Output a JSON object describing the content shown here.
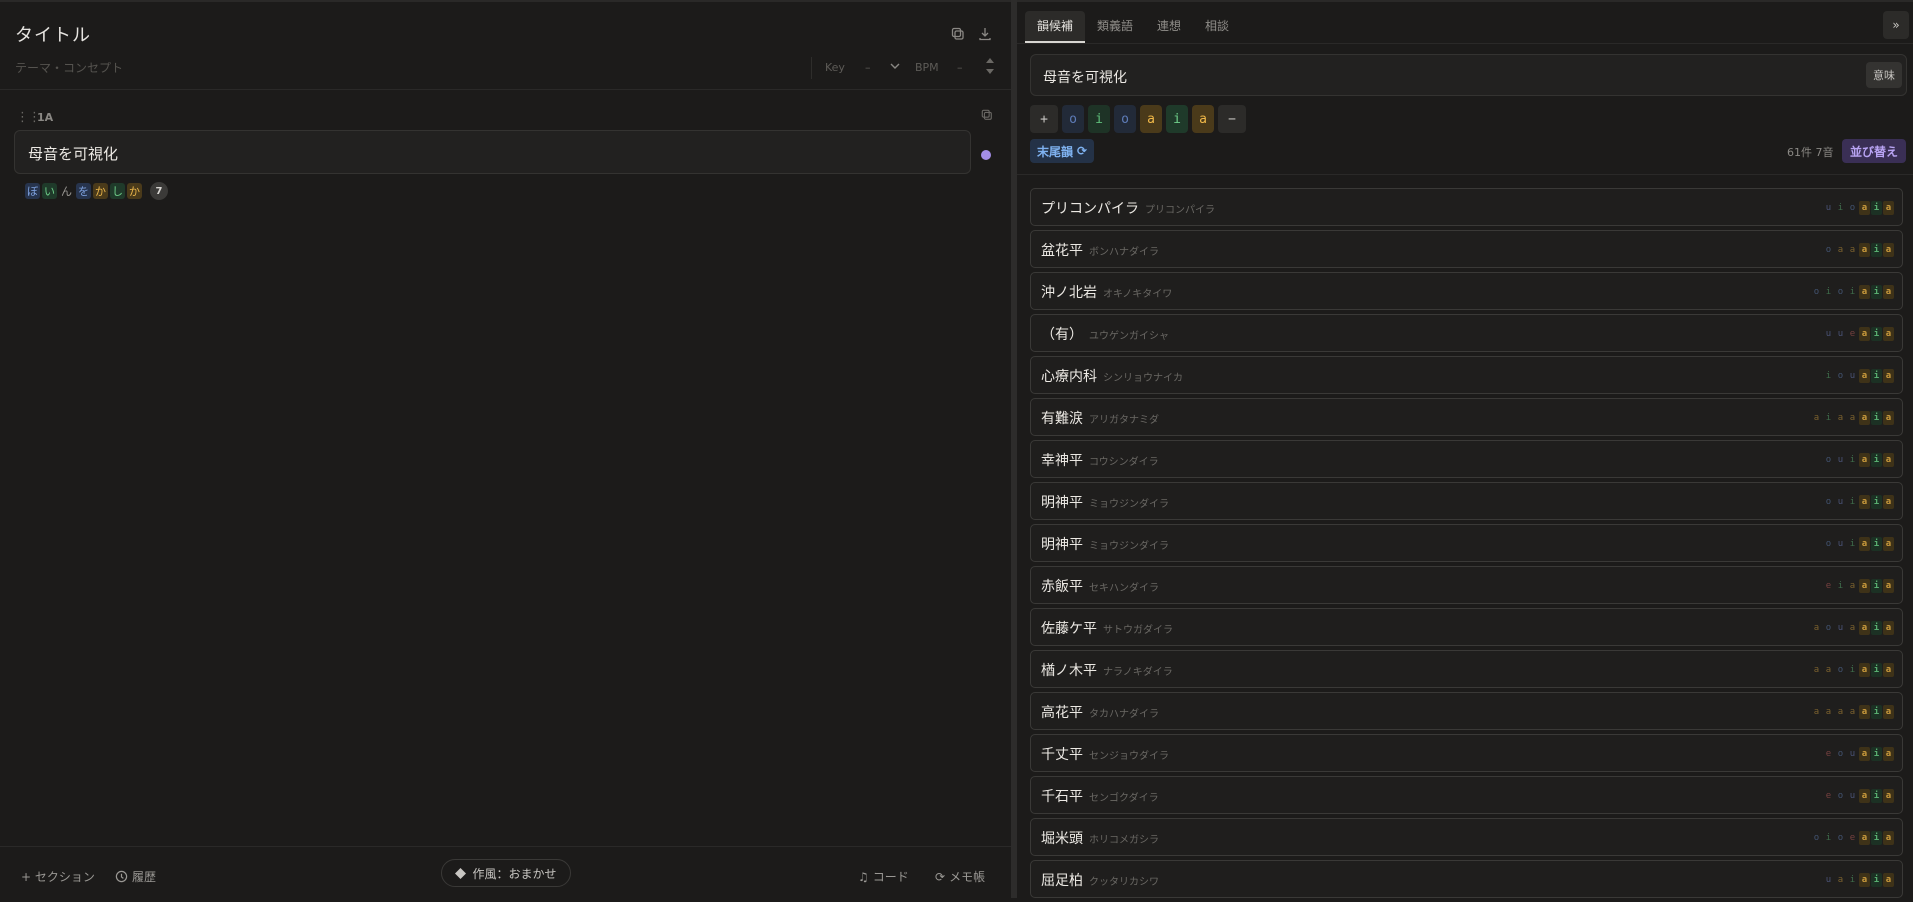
{
  "left": {
    "title": "タイトル",
    "theme_placeholder": "テーマ・コンセプト",
    "key_label": "Key",
    "key_value": "–",
    "bpm_label": "BPM",
    "bpm_value": "–",
    "section": {
      "label": "1A",
      "lyric": "母音を可視化",
      "kana": [
        {
          "char": "ぼ",
          "vowel": "o"
        },
        {
          "char": "い",
          "vowel": "i"
        },
        {
          "char": "ん",
          "vowel": "n"
        },
        {
          "char": "を",
          "vowel": "o"
        },
        {
          "char": "か",
          "vowel": "a"
        },
        {
          "char": "し",
          "vowel": "i"
        },
        {
          "char": "か",
          "vowel": "a"
        }
      ],
      "count": "7"
    },
    "bottom": {
      "add_section": "+ セクション",
      "history": "履歴",
      "style": "作風：おまかせ",
      "chord": "コード",
      "memo": "メモ帳"
    }
  },
  "right": {
    "tabs": [
      "韻候補",
      "類義語",
      "連想",
      "相談"
    ],
    "expand": "»",
    "query": "母音を可視化",
    "meaning_button": "意味",
    "vowel_pattern": [
      "o",
      "i",
      "o",
      "a",
      "i",
      "a"
    ],
    "plus": "+",
    "minus": "−",
    "rhyme_mode": "末尾韻",
    "result_count": "61件 7音",
    "sort_button": "並び替え",
    "results": [
      {
        "name": "プリコンパイラ",
        "kana": "プリコンパイラ",
        "vowels": "uioaia"
      },
      {
        "name": "盆花平",
        "kana": "ボンハナダイラ",
        "vowels": "oaaaia"
      },
      {
        "name": "沖ノ北岩",
        "kana": "オキノキタイワ",
        "vowels": "oioiaia"
      },
      {
        "name": "（有）",
        "kana": "ユウゲンガイシャ",
        "vowels": "uueaia"
      },
      {
        "name": "心療内科",
        "kana": "シンリョウナイカ",
        "vowels": "iouaia"
      },
      {
        "name": "有難涙",
        "kana": "アリガタナミダ",
        "vowels": "aiaaaia"
      },
      {
        "name": "幸神平",
        "kana": "コウシンダイラ",
        "vowels": "ouiaia"
      },
      {
        "name": "明神平",
        "kana": "ミョウジンダイラ",
        "vowels": "ouiaia"
      },
      {
        "name": "明神平",
        "kana": "ミョウジンダイラ",
        "vowels": "ouiaia"
      },
      {
        "name": "赤飯平",
        "kana": "セキハンダイラ",
        "vowels": "eiaaia"
      },
      {
        "name": "佐藤ケ平",
        "kana": "サトウガダイラ",
        "vowels": "aouaaia"
      },
      {
        "name": "楢ノ木平",
        "kana": "ナラノキダイラ",
        "vowels": "aaoiaia"
      },
      {
        "name": "高花平",
        "kana": "タカハナダイラ",
        "vowels": "aaaaaia"
      },
      {
        "name": "千丈平",
        "kana": "センジョウダイラ",
        "vowels": "eouaia"
      },
      {
        "name": "千石平",
        "kana": "センゴクダイラ",
        "vowels": "eouaia"
      },
      {
        "name": "堀米頭",
        "kana": "ホリコメガシラ",
        "vowels": "oioeaia"
      },
      {
        "name": "屈足柏",
        "kana": "クッタリカシワ",
        "vowels": "uaiaia"
      }
    ]
  },
  "colors": {
    "vowel_a": "#e0a83a",
    "vowel_i": "#5fbf7a",
    "vowel_u": "#7a8fd8",
    "vowel_e": "#d86a6a",
    "vowel_o": "#6a8ec8",
    "accent_purple": "#a48ee8"
  },
  "icons": [
    "copy-icon",
    "download-icon",
    "chevron-down-icon",
    "stepper-icon",
    "drag-handle-icon",
    "clock-icon",
    "diamond-icon",
    "music-note-icon",
    "refresh-icon"
  ]
}
